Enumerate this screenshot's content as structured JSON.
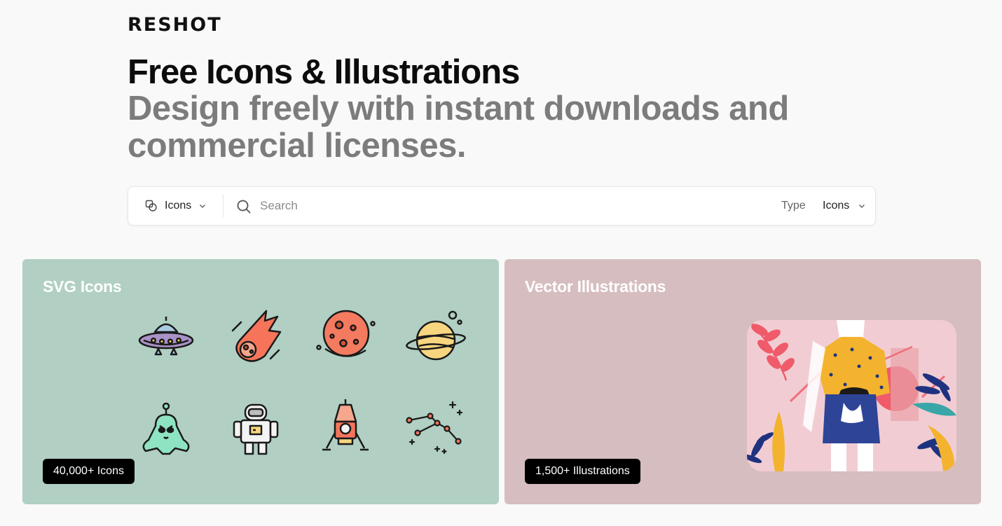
{
  "brand": {
    "logo": "RESHOT"
  },
  "hero": {
    "title": "Free Icons & Illustrations",
    "subtitle": "Design freely with instant downloads and commercial licenses."
  },
  "search": {
    "scope_label": "Icons",
    "placeholder": "Search",
    "value": "",
    "type_label": "Type",
    "type_value": "Icons"
  },
  "cards": {
    "icons": {
      "title": "SVG Icons",
      "badge": "40,000+ Icons",
      "background": "#b1cfc3",
      "preview_icons": [
        "ufo-icon",
        "meteor-icon",
        "planet-icon",
        "saturn-icon",
        "alien-icon",
        "astronaut-icon",
        "lunar-lander-icon",
        "constellation-icon"
      ]
    },
    "illustrations": {
      "title": "Vector Illustrations",
      "badge": "1,500+ Illustrations",
      "background": "#d6bdbf"
    }
  },
  "colors": {
    "page_bg": "#f9f9f9",
    "title": "#0c0c0c",
    "subtitle": "#7c7c7c",
    "badge_bg": "#000000"
  }
}
